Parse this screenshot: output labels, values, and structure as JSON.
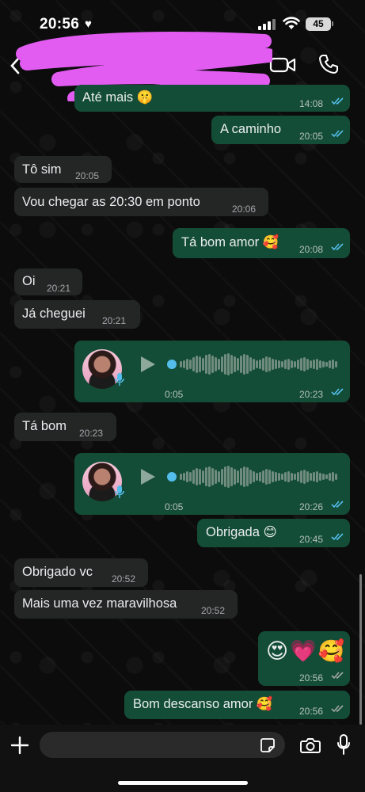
{
  "status_bar": {
    "time": "20:56",
    "battery": "45"
  },
  "header": {
    "contact_name": ""
  },
  "input": {
    "placeholder": ""
  },
  "messages": [
    {
      "dir": "out",
      "text": "Até mais 🤫",
      "time": "14:08",
      "status": "read"
    },
    {
      "dir": "out",
      "text": "A caminho",
      "time": "20:05",
      "status": "read"
    },
    {
      "dir": "in",
      "text": "Tô sim",
      "time": "20:05"
    },
    {
      "dir": "in",
      "text": "Vou chegar as 20:30 em ponto",
      "time": "20:06"
    },
    {
      "dir": "out",
      "text": "Tá bom amor 🥰",
      "time": "20:08",
      "status": "read"
    },
    {
      "dir": "in",
      "text": "Oi",
      "time": "20:21"
    },
    {
      "dir": "in",
      "text": "Já cheguei",
      "time": "20:21"
    },
    {
      "dir": "out",
      "type": "voice",
      "duration": "0:05",
      "time": "20:23",
      "status": "read"
    },
    {
      "dir": "in",
      "text": "Tá bom",
      "time": "20:23"
    },
    {
      "dir": "out",
      "type": "voice",
      "duration": "0:05",
      "time": "20:26",
      "status": "read"
    },
    {
      "dir": "out",
      "text": "Obrigada 😊",
      "time": "20:45",
      "status": "read"
    },
    {
      "dir": "in",
      "text": "Obrigado vc",
      "time": "20:52"
    },
    {
      "dir": "in",
      "text": "Mais uma vez maravilhosa",
      "time": "20:52"
    },
    {
      "dir": "out",
      "text": "😍💗🥰",
      "time": "20:56",
      "status": "delivered"
    },
    {
      "dir": "out",
      "text": "Bom descanso amor 🥰",
      "time": "20:56",
      "status": "delivered"
    }
  ],
  "colors": {
    "outgoing_bubble": "#144d37",
    "incoming_bubble": "#242626",
    "read_ticks": "#53bdeb",
    "delivered_ticks": "#a3a7a9",
    "redaction": "#e25cf2"
  },
  "icons": [
    "back-icon",
    "video-call-icon",
    "phone-icon",
    "play-icon",
    "mic-icon",
    "plus-icon",
    "sticker-icon",
    "camera-icon"
  ]
}
